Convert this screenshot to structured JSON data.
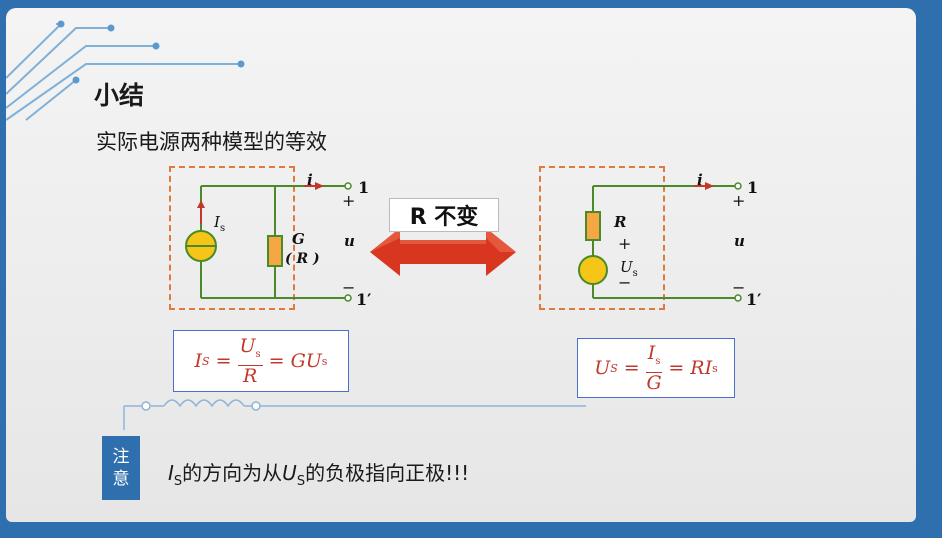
{
  "title": "小结",
  "subtitle": "实际电源两种模型的等效",
  "arrow_label": "R 不变",
  "left_circuit": {
    "current_label": "i",
    "terminal_top": "1",
    "terminal_bottom": "1′",
    "plus": "+",
    "minus": "−",
    "voltage_label": "u",
    "source_label": "I",
    "source_sub": "s",
    "conductance_label": "G",
    "resistance_label": "( R )"
  },
  "right_circuit": {
    "current_label": "i",
    "terminal_top": "1",
    "terminal_bottom": "1′",
    "plus": "+",
    "minus": "−",
    "voltage_label": "u",
    "resistor_label": "R",
    "source_plus": "+",
    "source_minus": "−",
    "source_label": "U",
    "source_sub": "s"
  },
  "formula_left": {
    "lhs": "I",
    "lhs_sub": "S",
    "eq1": "=",
    "num": "U",
    "num_sub": "s",
    "den": "R",
    "eq2": "=",
    "rhs": "GU",
    "rhs_sub": "s"
  },
  "formula_right": {
    "lhs": "U",
    "lhs_sub": "S",
    "eq1": "=",
    "num": "I",
    "num_sub": "s",
    "den": "G",
    "eq2": "=",
    "rhs": "RI",
    "rhs_sub": "s"
  },
  "note": {
    "badge_line1": "注",
    "badge_line2": "意",
    "text_i": "I",
    "text_i_sub": "S",
    "text_part1": "的方向为从",
    "text_u": "U",
    "text_u_sub": "S",
    "text_part2": "的负极指向正极!!!"
  },
  "colors": {
    "frame": "#2f6fae",
    "dash": "#e07a3c",
    "wire": "#4a8a2a",
    "source_fill": "#f5c518",
    "resistor_fill": "#f4a742",
    "formula_text": "#c0392b",
    "formula_border": "#4b6fd0",
    "arrow": "#d9361f"
  }
}
